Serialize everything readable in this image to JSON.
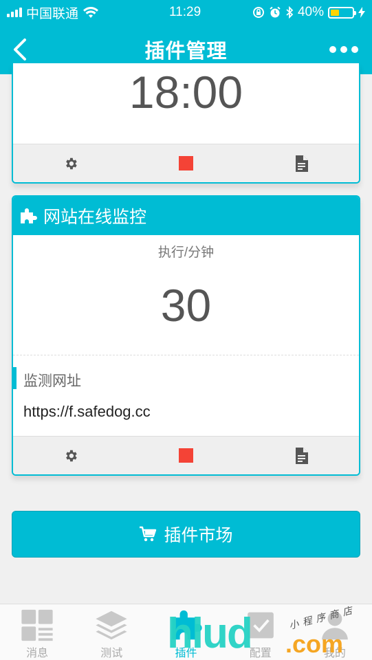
{
  "status_bar": {
    "carrier": "中国联通",
    "time": "11:29",
    "battery_percent": "40%",
    "battery_level": 0.4
  },
  "nav": {
    "title": "插件管理",
    "back_icon": "chevron-left-icon",
    "more_icon": "more-dots-icon"
  },
  "card_top": {
    "value": "18:00",
    "actions": [
      "gear-icon",
      "stop-icon",
      "log-document-icon"
    ]
  },
  "card_monitor": {
    "title": "网站在线监控",
    "icon": "puzzle-icon",
    "frequency_label": "执行/分钟",
    "frequency_value": "30",
    "field_label": "监测网址",
    "field_value": "https://f.safedog.cc",
    "actions": [
      "gear-icon",
      "stop-icon",
      "log-document-icon"
    ]
  },
  "market_button": {
    "label": "插件市场",
    "icon": "cart-icon"
  },
  "tabs": [
    {
      "label": "消息",
      "icon": "message-grid-icon",
      "active": false
    },
    {
      "label": "测试",
      "icon": "layers-icon",
      "active": false
    },
    {
      "label": "插件",
      "icon": "puzzle-icon",
      "active": true
    },
    {
      "label": "配置",
      "icon": "config-icon",
      "active": false
    },
    {
      "label": "我的",
      "icon": "user-icon",
      "active": false
    }
  ],
  "watermark": {
    "text": "hlud.com",
    "script": "小程序商店"
  },
  "colors": {
    "accent": "#00bcd4",
    "stop": "#f44336",
    "battery": "#ffd400"
  }
}
